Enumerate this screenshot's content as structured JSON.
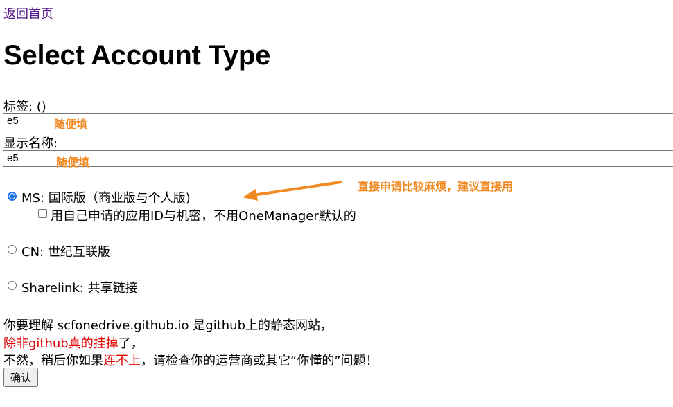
{
  "nav": {
    "back_label": "返回首页"
  },
  "page": {
    "title": "Select Account Type"
  },
  "form": {
    "tag_label": "标签: ()",
    "tag_value": "e5",
    "tag_hint": "随便填",
    "display_name_label": "显示名称:",
    "display_name_value": "e5",
    "display_name_hint": "随便填",
    "options": [
      {
        "label": "MS: 国际版（商业版与个人版)",
        "selected": true
      },
      {
        "label": "CN: 世纪互联版",
        "selected": false
      },
      {
        "label": "Sharelink: 共享链接",
        "selected": false
      }
    ],
    "own_app_checkbox_label": "用自己申请的应用ID与机密，不用OneManager默认的",
    "annotation": "直接申请比较麻烦，建议直接用",
    "annotation_color": "#f08a24",
    "confirm_label": "确认"
  },
  "notice": {
    "line1": "你要理解 scfonedrive.github.io 是github上的静态网站，",
    "line2_red": "除非github真的挂掉",
    "line2_tail": "了，",
    "line3_a": "不然，稍后你如果",
    "line3_red": "连不上",
    "line3_b": "，请检查你的运营商或其它“你懂的”问题！",
    "accent_red": "#e00000"
  }
}
